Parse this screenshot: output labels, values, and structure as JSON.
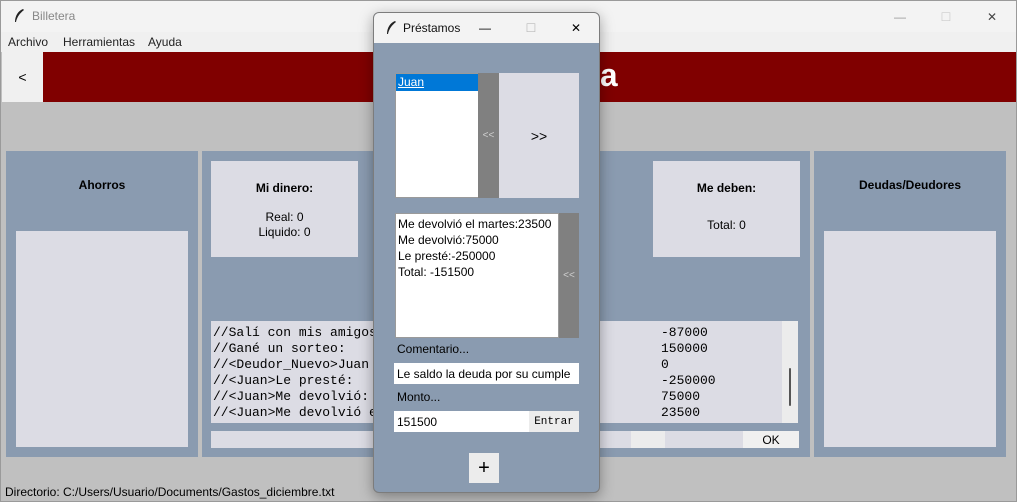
{
  "window": {
    "title": "Billetera",
    "minimize": "—",
    "maximize": "☐",
    "close": "✕"
  },
  "menu": {
    "archivo": "Archivo",
    "herramientas": "Herramientas",
    "ayuda": "Ayuda"
  },
  "header": {
    "back": "<",
    "title_fragment": "nta"
  },
  "ahorros": {
    "title": "Ahorros"
  },
  "mi_dinero": {
    "title": "Mi dinero:",
    "real": "Real: 0",
    "liquido": "Liquido: 0"
  },
  "me_deben": {
    "title": "Me deben:",
    "total": "Total: 0"
  },
  "deudas": {
    "title": "Deudas/Deudores"
  },
  "log": {
    "lines": [
      "//Salí con mis amigos",
      "//Gané un sorteo:",
      "//<Deudor_Nuevo>Juan",
      "//<Juan>Le presté:",
      "//<Juan>Me devolvió:",
      "//<Juan>Me devolvió e"
    ],
    "amounts": [
      "-87000",
      "150000",
      "0",
      "-250000",
      "75000",
      "23500"
    ]
  },
  "ok_button": "OK",
  "status": "Directorio: C:/Users/Usuario/Documents/Gastos_diciembre.txt",
  "dialog": {
    "title": "Préstamos",
    "minimize": "—",
    "maximize": "☐",
    "close": "✕",
    "debtors": [
      "Juan"
    ],
    "left_arrow": "<<",
    "right_arrow": ">>",
    "history": [
      "Me devolvió el martes:23500",
      "Me devolvió:75000",
      "Le presté:-250000",
      "Total: -151500"
    ],
    "history_arrow": "<<",
    "comment_label": "Comentario...",
    "comment_value": "Le saldo la deuda por su cumple",
    "amount_label": "Monto...",
    "amount_value": "151500",
    "enter_button": "Entrar",
    "add_button": "+"
  }
}
